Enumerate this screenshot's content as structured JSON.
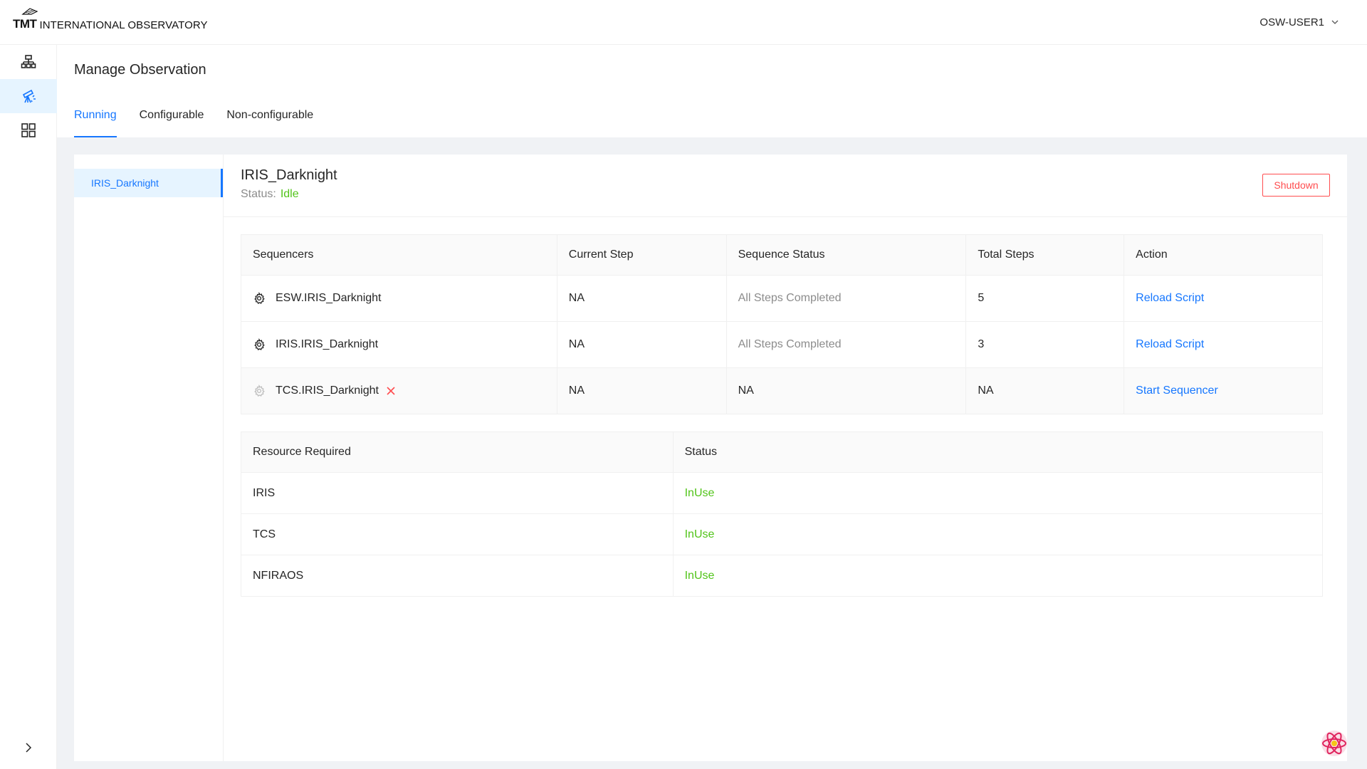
{
  "header": {
    "logo_bold": "TMT",
    "logo_text": "INTERNATIONAL OBSERVATORY",
    "user": "OSW-USER1"
  },
  "sidebar": {
    "items": [
      {
        "icon": "hierarchy-icon"
      },
      {
        "icon": "telescope-icon",
        "active": true
      },
      {
        "icon": "grid-icon"
      }
    ]
  },
  "page": {
    "title": "Manage Observation",
    "tabs": [
      {
        "label": "Running",
        "active": true
      },
      {
        "label": "Configurable"
      },
      {
        "label": "Non-configurable"
      }
    ]
  },
  "observations": [
    {
      "name": "IRIS_Darknight",
      "active": true
    }
  ],
  "detail": {
    "title": "IRIS_Darknight",
    "status_label": "Status:",
    "status_value": "Idle",
    "shutdown_label": "Shutdown"
  },
  "sequencers": {
    "headers": [
      "Sequencers",
      "Current Step",
      "Sequence Status",
      "Total Steps",
      "Action"
    ],
    "rows": [
      {
        "name": "ESW.IRIS_Darknight",
        "current_step": "NA",
        "status": "All Steps Completed",
        "total_steps": "5",
        "action": "Reload Script"
      },
      {
        "name": "IRIS.IRIS_Darknight",
        "current_step": "NA",
        "status": "All Steps Completed",
        "total_steps": "3",
        "action": "Reload Script"
      },
      {
        "name": "TCS.IRIS_Darknight",
        "current_step": "NA",
        "status": "NA",
        "total_steps": "NA",
        "action": "Start Sequencer"
      }
    ]
  },
  "resources": {
    "headers": [
      "Resource Required",
      "Status"
    ],
    "rows": [
      {
        "name": "IRIS",
        "status": "InUse"
      },
      {
        "name": "TCS",
        "status": "InUse"
      },
      {
        "name": "NFIRAOS",
        "status": "InUse"
      }
    ]
  },
  "colors": {
    "primary": "#1677ff",
    "success": "#52c41a",
    "danger": "#ff4d4f"
  }
}
